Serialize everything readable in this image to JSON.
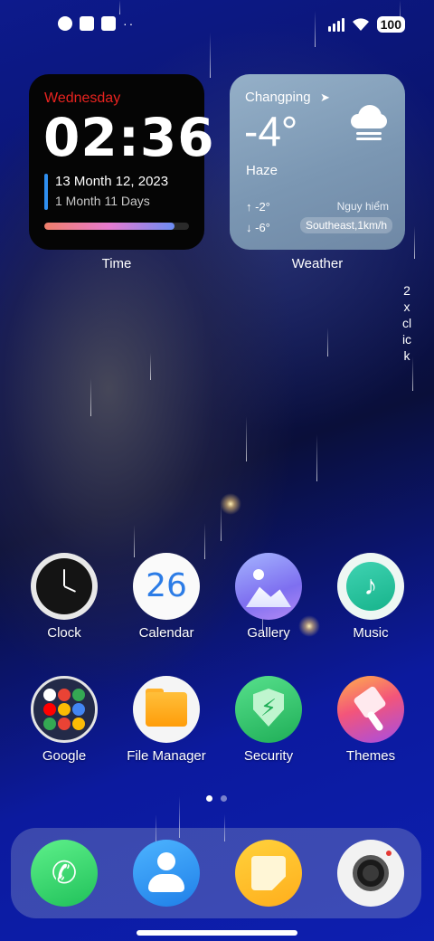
{
  "status_bar": {
    "battery": "100",
    "overflow": "··"
  },
  "time_widget": {
    "day": "Wednesday",
    "time": "02:36",
    "date": "13 Month 12, 2023",
    "lunar": "1 Month 11 Days",
    "progress_fraction": 0.9,
    "label": "Time"
  },
  "weather_widget": {
    "city": "Changping",
    "location_icon": "➤",
    "temperature": "-4°",
    "condition": "Haze",
    "high": "↑ -2°",
    "low": "↓ -6°",
    "risk": "Nguy hiểm",
    "wind": "Southeast,1km/h",
    "label": "Weather"
  },
  "side_text": "2\nx\ncl\nic\nk",
  "apps_row1": [
    {
      "label": "Clock"
    },
    {
      "label": "Calendar",
      "number": "26"
    },
    {
      "label": "Gallery"
    },
    {
      "label": "Music"
    }
  ],
  "apps_row2": [
    {
      "label": "Google"
    },
    {
      "label": "File Manager"
    },
    {
      "label": "Security"
    },
    {
      "label": "Themes"
    }
  ],
  "dock": [
    "Phone",
    "Contacts",
    "Notes",
    "Camera"
  ],
  "colors": {
    "day_red": "#e8231f",
    "accent_blue": "#2f8ff0"
  }
}
